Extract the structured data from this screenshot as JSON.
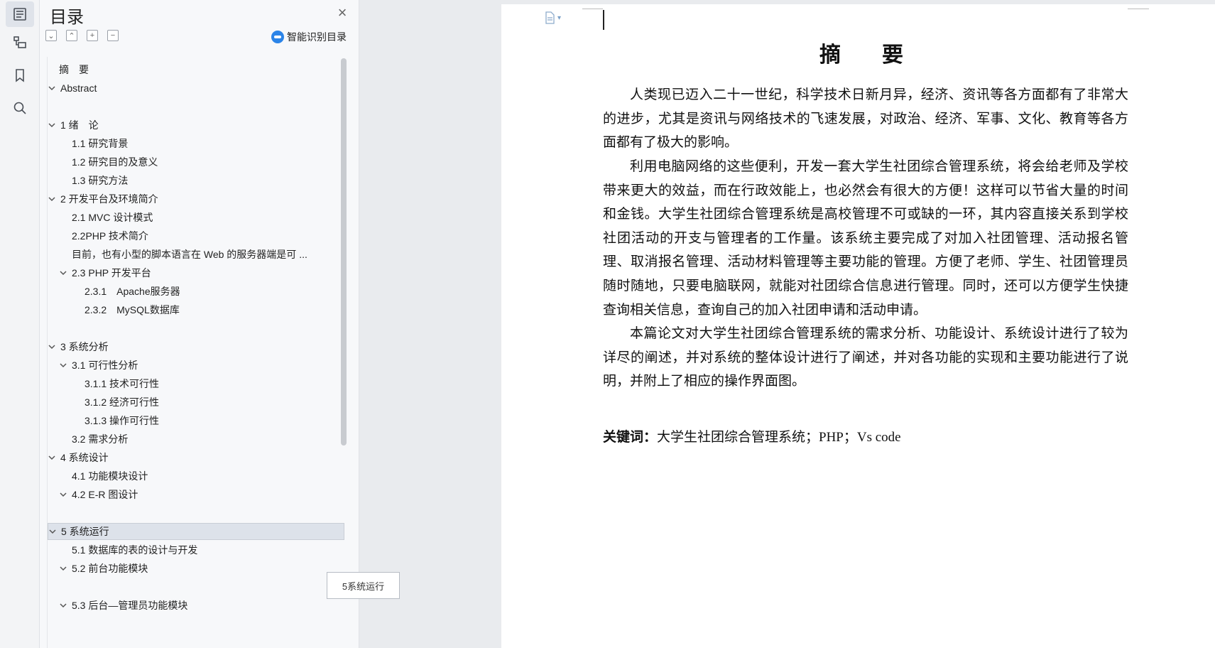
{
  "rail": {
    "items": [
      "toc",
      "navigation",
      "bookmark",
      "search"
    ]
  },
  "toc": {
    "title": "目录",
    "smart_label": "智能识别目录",
    "tooltip": "5系统运行",
    "items": [
      {
        "label": "摘　要",
        "level": 0,
        "expand": false,
        "selected": false
      },
      {
        "label": "Abstract",
        "level": 0,
        "expand": true,
        "selected": false
      },
      {
        "label": "",
        "level": 0,
        "expand": false,
        "selected": false
      },
      {
        "label": "1 绪　论",
        "level": 0,
        "expand": true,
        "selected": false
      },
      {
        "label": "1.1 研究背景",
        "level": 1,
        "expand": false,
        "selected": false
      },
      {
        "label": "1.2 研究目的及意义",
        "level": 1,
        "expand": false,
        "selected": false
      },
      {
        "label": "1.3 研究方法",
        "level": 1,
        "expand": false,
        "selected": false
      },
      {
        "label": "2 开发平台及环境简介",
        "level": 0,
        "expand": true,
        "selected": false
      },
      {
        "label": "2.1 MVC 设计模式",
        "level": 1,
        "expand": false,
        "selected": false
      },
      {
        "label": "2.2PHP 技术简介",
        "level": 1,
        "expand": false,
        "selected": false
      },
      {
        "label": "目前，也有小型的脚本语言在 Web 的服务器端是可 ...",
        "level": 1,
        "expand": false,
        "selected": false
      },
      {
        "label": "2.3 PHP 开发平台",
        "level": 1,
        "expand": true,
        "selected": false
      },
      {
        "label": "2.3.1　Apache服务器",
        "level": 2,
        "expand": false,
        "selected": false
      },
      {
        "label": "2.3.2　MySQL数据库",
        "level": 2,
        "expand": false,
        "selected": false
      },
      {
        "label": "",
        "level": 0,
        "expand": false,
        "selected": false
      },
      {
        "label": "3 系统分析",
        "level": 0,
        "expand": true,
        "selected": false
      },
      {
        "label": "3.1 可行性分析",
        "level": 1,
        "expand": true,
        "selected": false
      },
      {
        "label": "3.1.1 技术可行性",
        "level": 2,
        "expand": false,
        "selected": false
      },
      {
        "label": "3.1.2 经济可行性",
        "level": 2,
        "expand": false,
        "selected": false
      },
      {
        "label": "3.1.3 操作可行性",
        "level": 2,
        "expand": false,
        "selected": false
      },
      {
        "label": "3.2 需求分析",
        "level": 1,
        "expand": false,
        "selected": false
      },
      {
        "label": "4 系统设计",
        "level": 0,
        "expand": true,
        "selected": false
      },
      {
        "label": "4.1 功能模块设计",
        "level": 1,
        "expand": false,
        "selected": false
      },
      {
        "label": "4.2 E-R 图设计",
        "level": 1,
        "expand": true,
        "selected": false
      },
      {
        "label": "",
        "level": 0,
        "expand": false,
        "selected": false
      },
      {
        "label": "5 系统运行",
        "level": 0,
        "expand": true,
        "selected": true
      },
      {
        "label": "5.1 数据库的表的设计与开发",
        "level": 1,
        "expand": false,
        "selected": false
      },
      {
        "label": "5.2 前台功能模块",
        "level": 1,
        "expand": true,
        "selected": false
      },
      {
        "label": "",
        "level": 0,
        "expand": false,
        "selected": false
      },
      {
        "label": "5.3 后台—管理员功能模块",
        "level": 1,
        "expand": true,
        "selected": false
      }
    ]
  },
  "document": {
    "title": "摘　要",
    "paragraphs": [
      "人类现已迈入二十一世纪，科学技术日新月异，经济、资讯等各方面都有了非常大的进步，尤其是资讯与网络技术的飞速发展，对政治、经济、军事、文化、教育等各方面都有了极大的影响。",
      "利用电脑网络的这些便利，开发一套大学生社团综合管理系统，将会给老师及学校带来更大的效益，而在行政效能上，也必然会有很大的方便！这样可以节省大量的时间和金钱。大学生社团综合管理系统是高校管理不可或缺的一环，其内容直接关系到学校社团活动的开支与管理者的工作量。该系统主要完成了对加入社团管理、活动报名管理、取消报名管理、活动材料管理等主要功能的管理。方便了老师、学生、社团管理员随时随地，只要电脑联网，就能对社团综合信息进行管理。同时，还可以方便学生快捷查询相关信息，查询自己的加入社团申请和活动申请。",
      "本篇论文对大学生社团综合管理系统的需求分析、功能设计、系统设计进行了较为详尽的阐述，并对系统的整体设计进行了阐述，并对各功能的实现和主要功能进行了说明，并附上了相应的操作界面图。"
    ],
    "keywords_label": "关键词：",
    "keywords": "大学生社团综合管理系统；PHP；Vs code"
  }
}
